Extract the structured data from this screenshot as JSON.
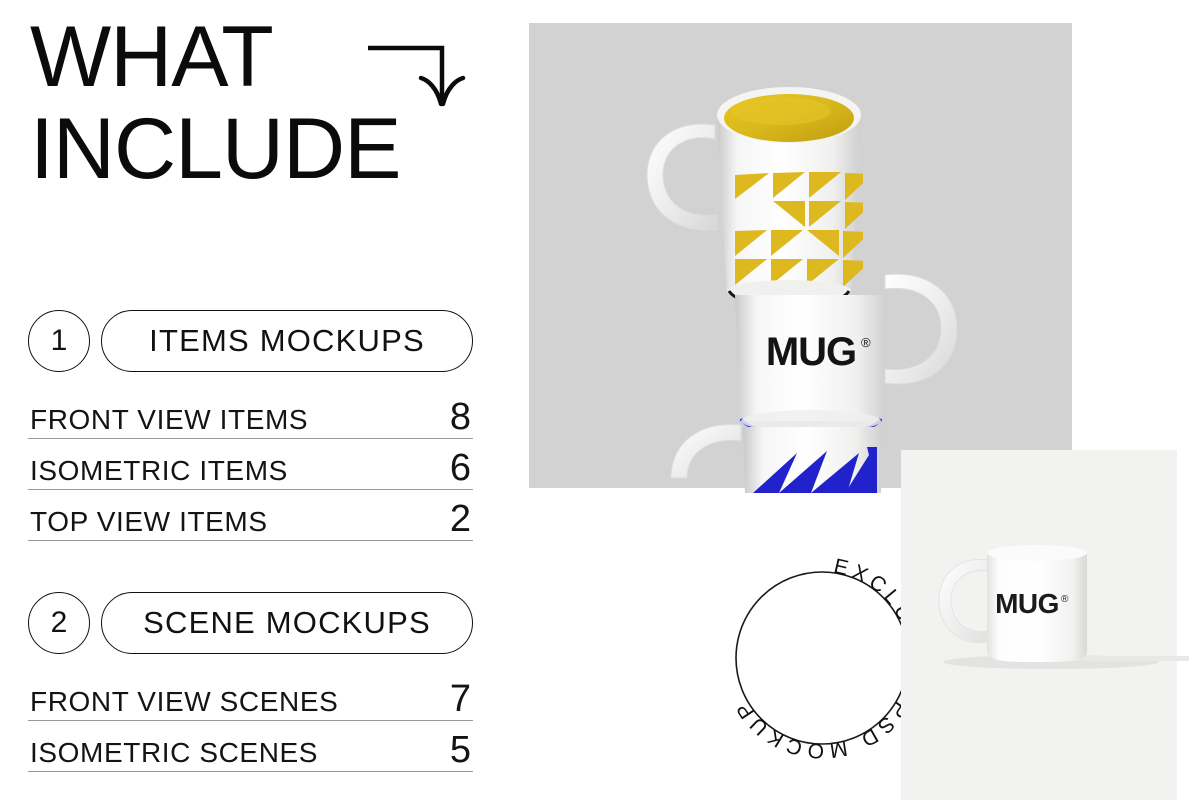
{
  "title": {
    "line1": "WHAT",
    "line2": "INCLUDE",
    "arrow_icon": "arrow-down-curved-icon"
  },
  "sections": [
    {
      "number": "1",
      "heading": "ITEMS MOCKUPS",
      "rows": [
        {
          "label": "FRONT VIEW ITEMS",
          "value": "8"
        },
        {
          "label": "ISOMETRIC ITEMS",
          "value": "6"
        },
        {
          "label": "TOP VIEW ITEMS",
          "value": "2"
        }
      ]
    },
    {
      "number": "2",
      "heading": "SCENE MOCKUPS",
      "rows": [
        {
          "label": "FRONT VIEW SCENES",
          "value": "7"
        },
        {
          "label": "ISOMETRIC SCENES",
          "value": "5"
        }
      ]
    }
  ],
  "artwork": {
    "gray_panel_color": "#d2d2d2",
    "light_panel_color": "#f2f2f1",
    "mug_brand": "MUG",
    "mug_brand_mark": "®",
    "yellow": "#d9b81c",
    "blue": "#2222cc",
    "stamp_text": "EXCLUSIVE PSD MOCKUP",
    "stamp_icon": "circular-stamp-badge"
  }
}
